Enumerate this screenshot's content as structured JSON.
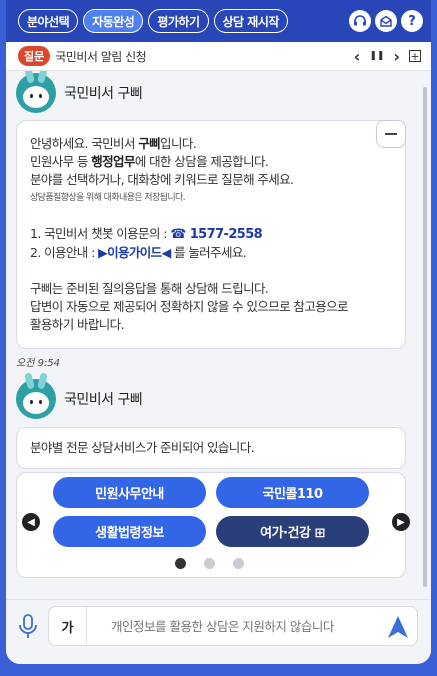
{
  "topbar": {
    "buttons": [
      {
        "label": "분야선택"
      },
      {
        "label": "자동완성"
      },
      {
        "label": "평가하기"
      },
      {
        "label": "상담 재시작"
      }
    ],
    "icons": [
      "headset-icon",
      "mail-icon",
      "help-icon"
    ]
  },
  "notice": {
    "badge": "질문",
    "text": "국민비서 알림 신청",
    "prev": "‹",
    "pause": "❚❚",
    "next": "›",
    "plus": "+"
  },
  "bot": {
    "name": "국민비서 구삐"
  },
  "message1": {
    "line1a": "안녕하세요. 국민비서 ",
    "line1b": "구삐",
    "line1c": "입니다.",
    "line2a": "민원사무 등 ",
    "line2b": "행정업무",
    "line2c": "에 대한 상담을 제공합니다.",
    "line3": "분야를 선택하거나, 대화창에 키워드로 질문해 주세요.",
    "line4": "상담품질향상을 위해 대화내용은 저장됩니다.",
    "item1_label": "1. 국민비서 챗봇 이용문의 : ",
    "item1_phone": "☎ 1577-2558",
    "item2_label": "2. 이용안내 : ",
    "item2_guide": "▶이용가이드◀",
    "item2_tail": " 를 눌러주세요.",
    "para3_line1": "구삐는 준비된 질의응답을 통해 상담해 드립니다.",
    "para3_line2": "답변이 자동으로 제공되어 정확하지 않을 수 있으므로 참고용으로",
    "para3_line3": "활용하기 바랍니다."
  },
  "time1": "오전 9:54",
  "message2": {
    "text": "분야별 전문 상담서비스가 준비되어 있습니다."
  },
  "menu": {
    "buttons": [
      {
        "label": "민원사무안내"
      },
      {
        "label": "국민콜110"
      },
      {
        "label": "생활법령정보"
      },
      {
        "label": "여가·건강 ⊞"
      }
    ],
    "prev": "◀",
    "next": "▶",
    "page_count": 3,
    "active_page": 1
  },
  "input": {
    "lang_toggle": "가",
    "placeholder": "개인정보를 활용한 상담은 지원하지 않습니다"
  },
  "colors": {
    "brand": "#2846b8",
    "accent": "#3366e6",
    "dark_button": "#2a3f7a",
    "badge": "#d9482b"
  }
}
